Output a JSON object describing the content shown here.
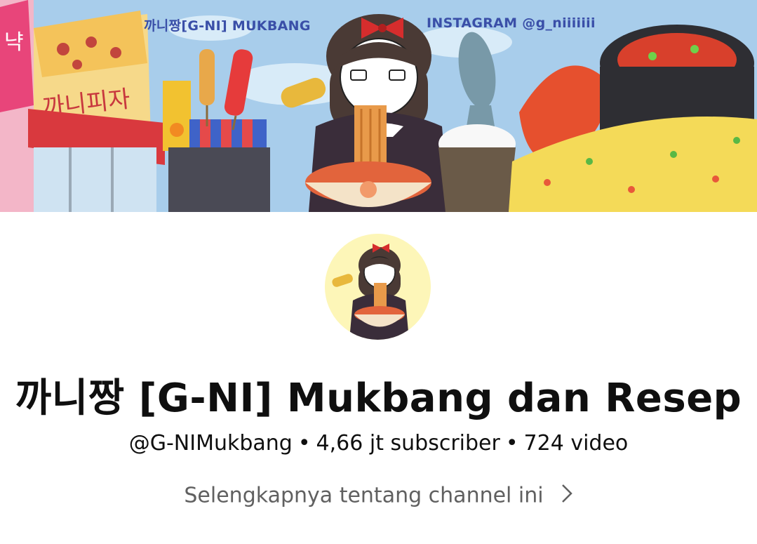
{
  "banner": {
    "left_caption": "까니짱[G-NI] MUKBANG",
    "right_caption": "INSTAGRAM @g_niiiiiii",
    "sign_text": "까니피자",
    "corner_text": "냑"
  },
  "channel": {
    "title": "까니짱 [G-NI] Mukbang dan Resep",
    "handle": "@G-NIMukbang",
    "subscribers": "4,66 jt subscriber",
    "videos": "724 video",
    "separator": "•",
    "more_label": "Selengkapnya tentang channel ini"
  },
  "colors": {
    "sky": "#9fc5e8",
    "title_text": "#0f0f0f",
    "secondary_text": "#606060",
    "banner_caption": "#3a4fa8"
  }
}
